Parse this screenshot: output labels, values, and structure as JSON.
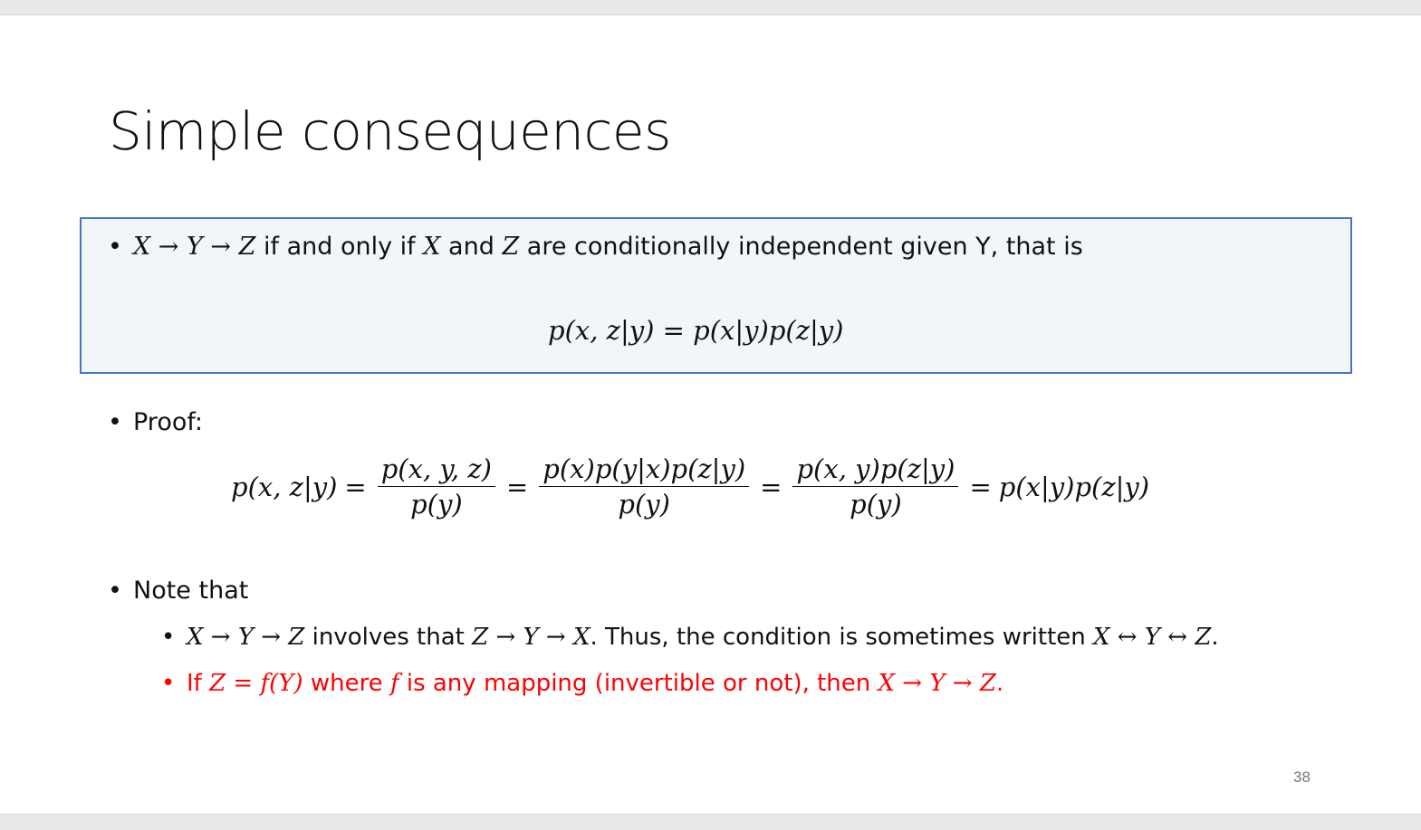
{
  "slide": {
    "title": "Simple consequences",
    "page_number": "38"
  },
  "box": {
    "bullet_chain": "X → Y → Z",
    "bullet_text1": " if and only if ",
    "bullet_x": "X",
    "bullet_text2": " and ",
    "bullet_z": "Z",
    "bullet_text3": " are conditionally independent given Y, that is",
    "equation": "p(x, z|y) = p(x|y)p(z|y)"
  },
  "proof": {
    "label": "Proof:",
    "lhs": "p(x, z|y)",
    "frac1_num": "p(x, y, z)",
    "frac1_den": "p(y)",
    "frac2_num": "p(x)p(y|x)p(z|y)",
    "frac2_den": "p(y)",
    "frac3_num": "p(x, y)p(z|y)",
    "frac3_den": "p(y)",
    "rhs": "p(x|y)p(z|y)",
    "eq_sign": "="
  },
  "note": {
    "label": "Note that",
    "sub1_chain": "X → Y → Z",
    "sub1_text1": " involves that ",
    "sub1_chain2": "Z → Y → X",
    "sub1_text2": ". Thus, the condition is sometimes written ",
    "sub1_chain3": "X ↔ Y ↔ Z",
    "sub1_text3": ".",
    "sub2_text1": "If ",
    "sub2_eq": "Z = f(Y)",
    "sub2_text2": " where ",
    "sub2_f": "f",
    "sub2_text3": " is any mapping (invertible or not), then ",
    "sub2_chain": "X → Y → Z",
    "sub2_text4": "."
  },
  "colors": {
    "box_border": "#4472c4",
    "box_fill": "#f2f6fa",
    "highlight_red": "#ff0000"
  }
}
